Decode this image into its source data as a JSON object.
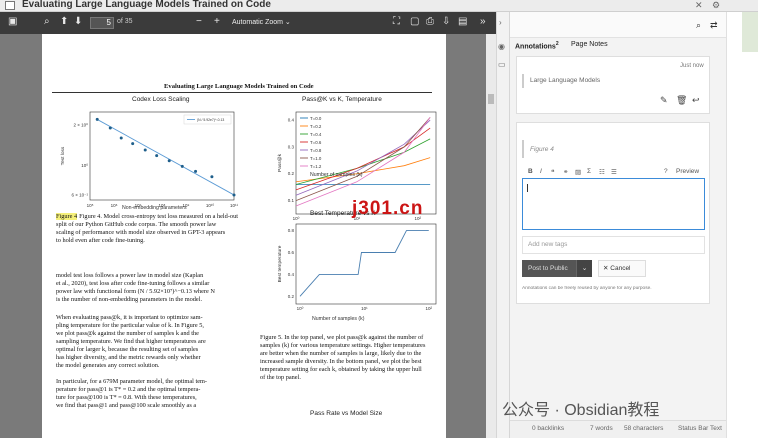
{
  "window": {
    "title": "Evaluating Large Language Models Trained on Code",
    "close_icon": "close-icon",
    "settings_icon": "gear-icon"
  },
  "pdf_toolbar": {
    "page_current": "5",
    "page_total": "of 35",
    "zoom": "Automatic Zoom"
  },
  "pdf_page": {
    "running_title": "Evaluating Large Language Models Trained on Code",
    "fig4_caption": [
      "Figure 4. Model cross-entropy test loss measured on a held-out",
      "split of our Python GitHub code corpus. The smooth power law",
      "scaling of performance with model size observed in GPT-3 appears",
      "to hold even after code fine-tuning."
    ],
    "body_para1": [
      "model test loss follows a power law in model size (Kaplan",
      "et al., 2020), test loss after code fine-tuning follows a similar",
      "power law with functional form (N / 5.92×10⁷)^−0.13 where N",
      "is the number of non-embedding parameters in the model."
    ],
    "body_para2": [
      "When evaluating pass@k, it is important to optimize sam-",
      "pling temperature for the particular value of k. In Figure 5,",
      "we plot pass@k against the number of samples k and the",
      "sampling temperature. We find that higher temperatures are",
      "optimal for larger k, because the resulting set of samples",
      "has higher diversity, and the metric rewards only whether",
      "the model generates any correct solution."
    ],
    "body_para3": [
      "In particular, for a 679M parameter model, the optimal tem-",
      "perature for pass@1 is T* = 0.2 and the optimal tempera-",
      "ture for pass@100 is T* = 0.8. With these temperatures,",
      "we find that pass@1 and pass@100 scale smoothly as a"
    ],
    "fig5_caption": [
      "Figure 5. In the top panel, we plot pass@k against the number of",
      "samples (k) for various temperature settings. Higher temperatures",
      "are better when the number of samples is large, likely due to the",
      "increased sample diversity. In the bottom panel, we plot the best",
      "temperature setting for each k, obtained by taking the upper hull",
      "of the top panel."
    ],
    "next_chart_title": "Pass Rate vs Model Size"
  },
  "chart_data": [
    {
      "type": "scatter",
      "title": "Codex Loss Scaling",
      "xlabel": "Non-embedding parameters",
      "ylabel": "Test loss",
      "xscale": "log",
      "yscale": "log",
      "x_ticks": [
        "10⁵",
        "10⁶",
        "10⁷",
        "10⁸",
        "10⁹",
        "10¹⁰",
        "10¹¹"
      ],
      "y_ticks": [
        "2 × 10⁰",
        "10⁰",
        "6 × 10⁻¹"
      ],
      "legend": "(N / 5.92e7)^-0.13",
      "x": [
        200000,
        700000,
        2000000,
        6000000,
        20000000,
        60000000,
        200000000,
        700000000,
        2500000000,
        12000000000,
        100000000000
      ],
      "y": [
        2.2,
        1.9,
        1.6,
        1.45,
        1.3,
        1.18,
        1.08,
        0.98,
        0.9,
        0.82,
        0.6
      ]
    },
    {
      "type": "line",
      "title": "Pass@K vs K, Temperature",
      "xlabel": "Number of samples (k)",
      "ylabel": "Pass@k",
      "xscale": "log",
      "x_ticks": [
        "10⁰",
        "10¹",
        "10²"
      ],
      "y_ticks": [
        "0.1",
        "0.2",
        "0.3",
        "0.4"
      ],
      "legend_placement": "top-left",
      "series": [
        {
          "name": "T=0.0",
          "color": "#1f77b4",
          "values": [
            0.16,
            0.16,
            0.16,
            0.16
          ]
        },
        {
          "name": "T=0.2",
          "color": "#ff7f0e",
          "values": [
            0.17,
            0.2,
            0.23,
            0.26
          ]
        },
        {
          "name": "T=0.4",
          "color": "#2ca02c",
          "values": [
            0.16,
            0.22,
            0.28,
            0.33
          ]
        },
        {
          "name": "T=0.6",
          "color": "#d62728",
          "values": [
            0.14,
            0.22,
            0.3,
            0.37
          ]
        },
        {
          "name": "T=0.8",
          "color": "#9467bd",
          "values": [
            0.12,
            0.21,
            0.31,
            0.4
          ]
        },
        {
          "name": "T=1.0",
          "color": "#8c564b",
          "values": [
            0.1,
            0.19,
            0.3,
            0.41
          ]
        },
        {
          "name": "T=1.2",
          "color": "#e377c2",
          "values": [
            0.08,
            0.17,
            0.28,
            0.41
          ]
        }
      ],
      "x": [
        1,
        3,
        10,
        30
      ]
    },
    {
      "type": "line",
      "title": "Best Temperature vs K",
      "xlabel": "Number of samples (k)",
      "ylabel": "Best temperature",
      "xscale": "log",
      "x_ticks": [
        "10⁰",
        "10¹",
        "10²"
      ],
      "y_ticks": [
        "0.2",
        "0.4",
        "0.6",
        "0.8"
      ],
      "x": [
        1,
        2,
        3,
        8,
        9,
        30,
        45,
        100
      ],
      "values": [
        0.2,
        0.4,
        0.4,
        0.4,
        0.6,
        0.6,
        0.8,
        0.8
      ]
    }
  ],
  "panel": {
    "tab_annotations": "Annotations",
    "tab_annotations_count": "2",
    "tab_page_notes": "Page Notes",
    "card1_time": "Just now",
    "card1_text": "Large Language Models",
    "card2_quote": "Figure 4",
    "preview_label": "Preview",
    "tags_placeholder": "Add new tags",
    "post_button": "Post to Public",
    "cancel_button": "Cancel",
    "notice": "Annotations can be freely reused by anyone for any purpose."
  },
  "status": {
    "backlinks": "0 backlinks",
    "words": "7 words",
    "chars": "58 characters",
    "status_text": "Status Bar Text"
  },
  "watermarks": {
    "cn": "j301.cn",
    "wechat": "公众号 · Obsidian教程"
  },
  "colors": {
    "pdf_toolbar": "#3b3b3b",
    "highlight": "#f5f07a",
    "post_button": "#555555",
    "editor_border": "#3b8bd9",
    "curve_fit": "#5b9bd5"
  }
}
